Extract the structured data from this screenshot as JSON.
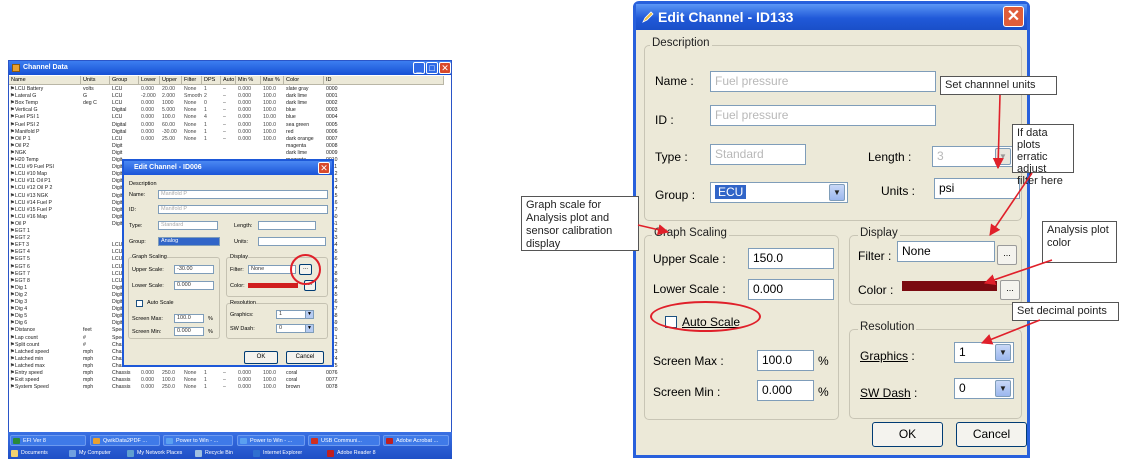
{
  "channel_data": {
    "title": "Channel Data",
    "columns": [
      "Name",
      "Units",
      "Group",
      "Lower",
      "Upper",
      "Filter",
      "DPS",
      "Auto",
      "Min %",
      "Max %",
      "Color",
      "ID"
    ],
    "rows": [
      [
        "LCU Battery",
        "volts",
        "LCU",
        "0.000",
        "20.00",
        "None",
        "1",
        "–",
        "0.000",
        "100.0",
        "slate gray",
        "0000"
      ],
      [
        "Lateral G",
        "G",
        "LCU",
        "-2.000",
        "2.000",
        "Smooth",
        "2",
        "–",
        "0.000",
        "100.0",
        "dark lime",
        "0001"
      ],
      [
        "Box Temp",
        "deg C",
        "LCU",
        "0.000",
        "1000",
        "None",
        "0",
        "–",
        "0.000",
        "100.0",
        "dark lime",
        "0002"
      ],
      [
        "Vertical G",
        "",
        "Digital",
        "0.000",
        "5.000",
        "None",
        "1",
        "–",
        "0.000",
        "100.0",
        "blue",
        "0003"
      ],
      [
        "Fuel PSI 1",
        "",
        "LCU",
        "0.000",
        "100.0",
        "None",
        "4",
        "–",
        "0.000",
        "10.00",
        "blue",
        "0004"
      ],
      [
        "Fuel PSI 2",
        "",
        "Digital",
        "0.000",
        "60.00",
        "None",
        "1",
        "–",
        "0.000",
        "100.0",
        "sea green",
        "0005"
      ],
      [
        "Manifold P",
        "",
        "Digital",
        "0.000",
        "-30.00",
        "None",
        "1",
        "–",
        "0.000",
        "100.0",
        "red",
        "0006"
      ],
      [
        "Oil P 1",
        "",
        "LCU",
        "0.000",
        "25.00",
        "None",
        "1",
        "–",
        "0.000",
        "100.0",
        "dark orange",
        "0007"
      ],
      [
        "Oil P2",
        "",
        "Digit",
        "",
        "",
        "",
        "",
        "",
        "",
        "",
        "magenta",
        "0008"
      ],
      [
        "NGK",
        "",
        "Digit",
        "",
        "",
        "",
        "",
        "",
        "",
        "",
        "dark lime",
        "0009"
      ],
      [
        "H20 Temp",
        "",
        "Digit",
        "",
        "",
        "",
        "",
        "",
        "",
        "",
        "magenta",
        "0010"
      ],
      [
        "LCU #9 Fuel PSI",
        "",
        "Digit",
        "",
        "",
        "",
        "",
        "",
        "",
        "",
        "slate blue",
        "0011"
      ],
      [
        "LCU #10 Map",
        "",
        "Digit",
        "",
        "",
        "",
        "",
        "",
        "",
        "",
        "dark lime",
        "0012"
      ],
      [
        "LCU #11 Oil P1",
        "",
        "Digit",
        "",
        "",
        "",
        "",
        "",
        "",
        "",
        "000:129:128",
        "0013"
      ],
      [
        "LCU #12 Oil P 2",
        "",
        "Digit",
        "",
        "",
        "",
        "",
        "",
        "",
        "",
        "medium blue",
        "0014"
      ],
      [
        "LCU #13 NGK",
        "",
        "Digit",
        "",
        "",
        "",
        "",
        "",
        "",
        "",
        "coral",
        "0015"
      ],
      [
        "LCU #14 Fuel P",
        "",
        "Digit",
        "",
        "",
        "",
        "",
        "",
        "",
        "",
        "coral",
        "0016"
      ],
      [
        "LCU #15 Fuel P",
        "",
        "Digit",
        "",
        "",
        "",
        "",
        "",
        "",
        "",
        "brown",
        "0017"
      ],
      [
        "LCU #16 Map",
        "",
        "Digit",
        "",
        "",
        "",
        "",
        "",
        "",
        "",
        "dark violet",
        "0050"
      ],
      [
        "Oil P",
        "",
        "Digit",
        "",
        "",
        "",
        "",
        "",
        "",
        "",
        "dark lime",
        "0051"
      ],
      [
        "EGT 1",
        "",
        "",
        "",
        "",
        "",
        "",
        "",
        "",
        "",
        "dark violet",
        "0052"
      ],
      [
        "EGT 2",
        "",
        "",
        "",
        "",
        "",
        "",
        "",
        "",
        "",
        "dark violet",
        "0053"
      ],
      [
        "EFT 3",
        "",
        "LCU",
        "",
        "",
        "",
        "",
        "",
        "",
        "",
        "dark orange",
        "0054"
      ],
      [
        "EGT 4",
        "",
        "LCU",
        "",
        "",
        "",
        "",
        "",
        "",
        "",
        "salmon",
        "0055"
      ],
      [
        "EGT 5",
        "",
        "LCU",
        "",
        "",
        "",
        "",
        "",
        "",
        "",
        "dark violet",
        "0056"
      ],
      [
        "EGT 6",
        "",
        "LCU",
        "",
        "",
        "",
        "",
        "",
        "",
        "",
        "sea green",
        "0057"
      ],
      [
        "EGT 7",
        "",
        "LCU",
        "",
        "",
        "",
        "",
        "",
        "",
        "",
        "dark violet",
        "0058"
      ],
      [
        "EGT 8",
        "",
        "LCU",
        "",
        "",
        "",
        "",
        "",
        "",
        "",
        "magenta",
        "0059"
      ],
      [
        "Dig 1",
        "",
        "Digit",
        "",
        "",
        "",
        "",
        "",
        "",
        "",
        "red",
        "0064"
      ],
      [
        "Dig 2",
        "",
        "Digit",
        "",
        "",
        "",
        "",
        "",
        "",
        "",
        "blue",
        "0065"
      ],
      [
        "Dig 3",
        "",
        "Digit",
        "",
        "",
        "",
        "",
        "",
        "",
        "",
        "red",
        "0066"
      ],
      [
        "Dig 4",
        "",
        "Digit",
        "",
        "",
        "",
        "",
        "",
        "",
        "",
        "saddle brown",
        "0067"
      ],
      [
        "Dig 5",
        "",
        "Digit",
        "",
        "",
        "",
        "",
        "",
        "",
        "",
        "dark orange",
        "0068"
      ],
      [
        "Dig 6",
        "",
        "Digit",
        "",
        "",
        "",
        "",
        "",
        "",
        "",
        "dark red",
        "0069"
      ],
      [
        "Distance",
        "feet",
        "Spee",
        "",
        "",
        "",
        "",
        "",
        "",
        "",
        "black",
        "0070"
      ],
      [
        "Lap count",
        "#",
        "Spee",
        "",
        "",
        "",
        "",
        "",
        "",
        "",
        "magenta",
        "0071"
      ],
      [
        "Split count",
        "#",
        "Chassis",
        "0.000",
        "10.00",
        "None",
        "1",
        "–",
        "0.000",
        "100.0",
        "slate blue",
        "0072"
      ],
      [
        "Latched speed",
        "mph",
        "Chassis",
        "0.000",
        "250.0",
        "None",
        "1",
        "–",
        "0.000",
        "100.0",
        "dark lime",
        "0073"
      ],
      [
        "Latched min",
        "mph",
        "Chassis",
        "0.000",
        "250.0",
        "None",
        "1",
        "–",
        "0.000",
        "100.0",
        "000:129:128",
        "0074"
      ],
      [
        "Latched max",
        "mph",
        "Chassis",
        "0.000",
        "250.0",
        "None",
        "1",
        "–",
        "0.000",
        "100.0",
        "medium blue",
        "0075"
      ],
      [
        "Entry speed",
        "mph",
        "Chassis",
        "0.000",
        "250.0",
        "None",
        "1",
        "–",
        "0.000",
        "100.0",
        "coral",
        "0076"
      ],
      [
        "Exit speed",
        "mph",
        "Chassis",
        "0.000",
        "100.0",
        "None",
        "1",
        "–",
        "0.000",
        "100.0",
        "coral",
        "0077"
      ],
      [
        "System Speed",
        "mph",
        "Chassis",
        "0.000",
        "250.0",
        "None",
        "1",
        "–",
        "0.000",
        "100.0",
        "brown",
        "0078"
      ]
    ]
  },
  "taskbar": {
    "buttons": [
      "EFI Ver 8",
      "QwikData2PDF ...",
      "Power to Win - ...",
      "Power to Win - ...",
      "USB Communi...",
      "Adobe Acrobat ..."
    ],
    "quicklaunch": [
      "Documents",
      "My Computer",
      "My Network Places",
      "Recycle Bin",
      "Internet Explorer",
      "Adobe Reader 8"
    ]
  },
  "small_dialog": {
    "title": "Edit Channel - ID006",
    "description_legend": "Description",
    "name_label": "Name:",
    "name_value": "Manifold P",
    "id_label": "ID:",
    "id_value": "Manifold P",
    "type_label": "Type:",
    "type_value": "Standard",
    "length_label": "Length:",
    "group_label": "Group:",
    "group_value": "Analog",
    "units_label": "Units:",
    "graph_legend": "Graph Scaling",
    "upper_label": "Upper Scale:",
    "upper_value": "-30.00",
    "lower_label": "Lower Scale:",
    "lower_value": "0.000",
    "auto_label": "Auto Scale",
    "screen_max_label": "Screen Max:",
    "screen_max_value": "100.0",
    "screen_min_label": "Screen Min:",
    "screen_min_value": "0.000",
    "pct": "%",
    "display_legend": "Display",
    "filter_label": "Filter:",
    "filter_value": "None",
    "color_label": "Color:",
    "resolution_legend": "Resolution",
    "graphics_label": "Graphics:",
    "graphics_value": "1",
    "swdash_label": "SW Dash:",
    "swdash_value": "0",
    "ok": "OK",
    "cancel": "Cancel"
  },
  "big_dialog": {
    "title": "Edit Channel - ID133",
    "description_legend": "Description",
    "name_label": "Name",
    "name_value": "Fuel pressure",
    "id_label": "ID",
    "id_value": "Fuel pressure",
    "type_label": "Type",
    "type_value": "Standard",
    "length_label": "Length",
    "length_value": "3",
    "group_label": "Group",
    "group_value": "ECU",
    "units_label": "Units",
    "units_value": "psi",
    "graph_legend": "Graph Scaling",
    "upper_label": "Upper Scale",
    "upper_value": "150.0",
    "lower_label": "Lower Scale",
    "lower_value": "0.000",
    "auto_label": "Auto Scale",
    "screen_max_label": "Screen Max",
    "screen_max_value": "100.0",
    "screen_min_label": "Screen Min",
    "screen_min_value": "0.000",
    "pct": "%",
    "display_legend": "Display",
    "filter_label": "Filter",
    "filter_value": "None",
    "color_label": "Color",
    "color_swatch": "#7a0a10",
    "resolution_legend": "Resolution",
    "graphics_label": "Graphics",
    "graphics_value": "1",
    "swdash_label": "SW Dash",
    "swdash_value": "0",
    "ok": "OK",
    "cancel": "Cancel"
  },
  "callouts": {
    "units": "Set channnel units",
    "filter": "If data plots erratic adjust filter here",
    "graph_scale": "Graph scale for Analysis plot and sensor calibration display",
    "color": "Analysis plot color",
    "decimals": "Set decimal points"
  },
  "colors": {
    "xp_blue": "#1f56d6",
    "highlight_red": "#e0202a",
    "dialog_face": "#ece9d8"
  }
}
